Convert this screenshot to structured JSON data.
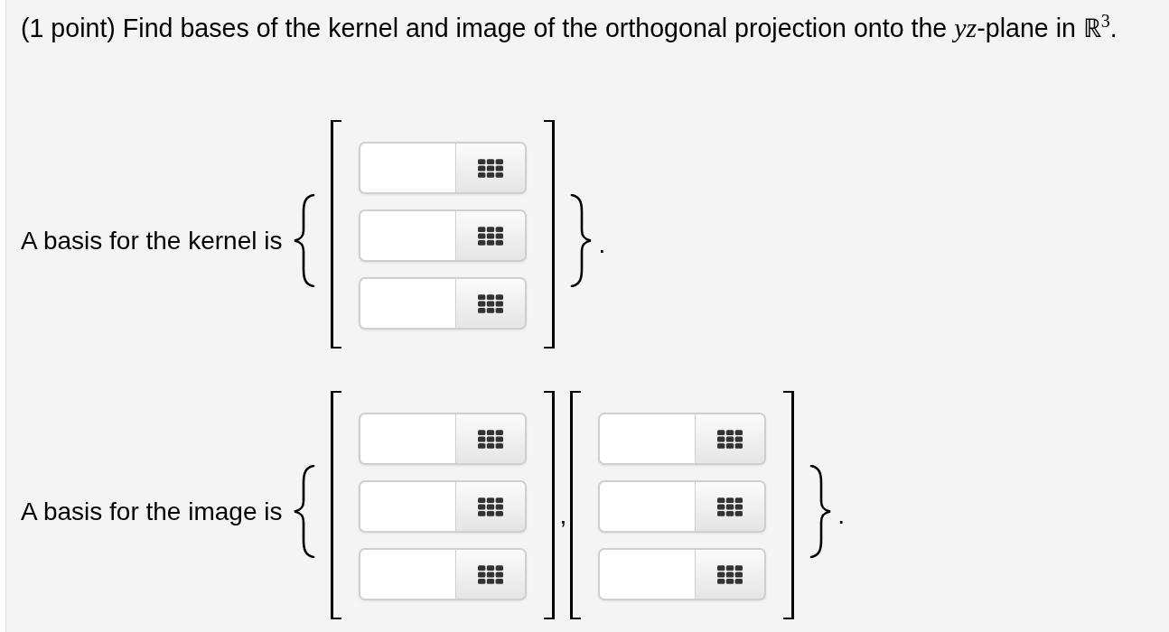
{
  "question": {
    "text": "(1 point) Find bases of the kernel and image of the orthogonal projection onto the *yz*-plane in ℝ$^{3}$."
  },
  "answers": [
    {
      "label": "A basis for the kernel is",
      "vectors": [
        {
          "entries": [
            {
              "kind": "blank"
            },
            {
              "kind": "blank"
            },
            {
              "kind": "blank"
            }
          ]
        }
      ],
      "closing": "."
    },
    {
      "label": "A basis for the image is",
      "vectors": [
        {
          "entries": [
            {
              "kind": "blank"
            },
            {
              "kind": "blank"
            },
            {
              "kind": "blank"
            }
          ],
          "delimiter": ","
        },
        {
          "entries": [
            {
              "kind": "blank"
            },
            {
              "kind": "blank"
            },
            {
              "kind": "blank"
            }
          ]
        }
      ],
      "closing": "."
    }
  ]
}
